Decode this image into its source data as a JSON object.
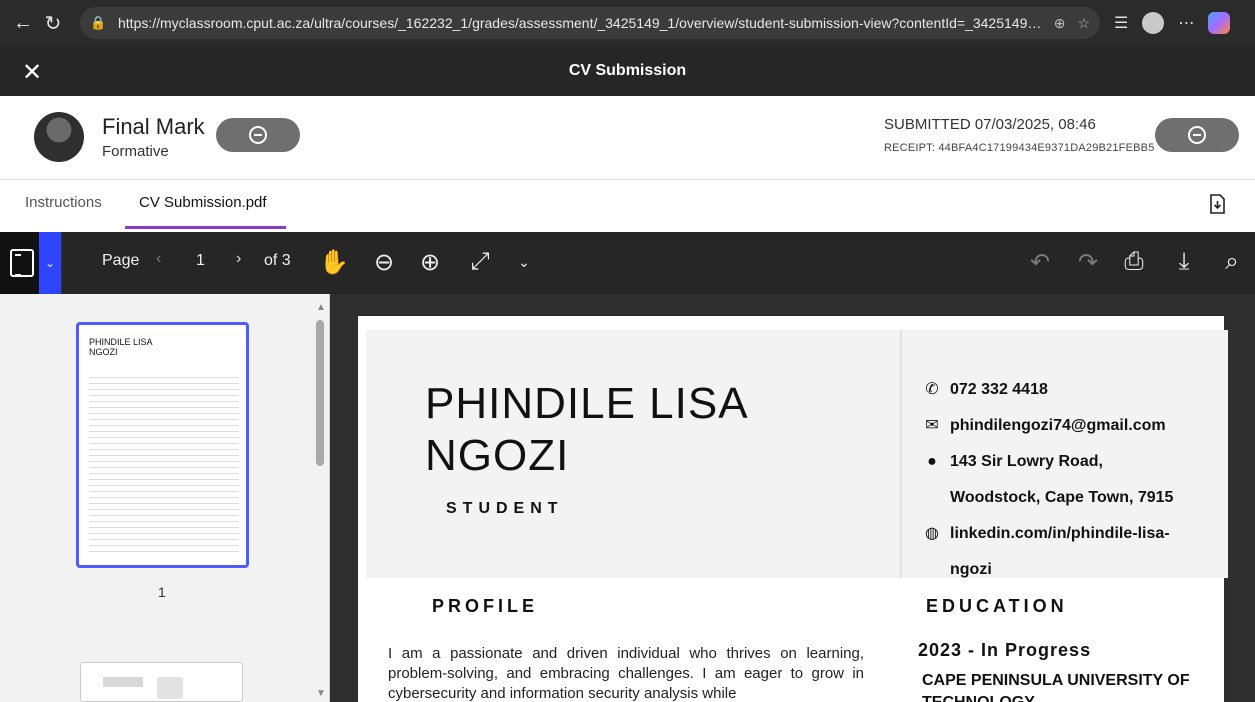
{
  "browser": {
    "url": "https://myclassroom.cput.ac.za/ultra/courses/_162232_1/grades/assessment/_3425149_1/overview/student-submission-view?contentId=_3425149_1&...",
    "back_icon": "back-arrow-icon",
    "refresh_icon": "refresh-icon"
  },
  "app": {
    "title": "CV Submission"
  },
  "marks": {
    "final_mark_label": "Final Mark",
    "final_mark_type": "Formative",
    "submitted": "SUBMITTED 07/03/2025, 08:46",
    "receipt": "RECEIPT: 44BFA4C17199434E9371DA29B21FEBB5"
  },
  "tabs": {
    "instructions": "Instructions",
    "submission": "CV Submission.pdf"
  },
  "toolbar": {
    "page_label": "Page",
    "page_number": "1",
    "of_label": "of 3"
  },
  "thumbnail": {
    "page_number": "1"
  },
  "cv": {
    "name_line1": "PHINDILE LISA",
    "name_line2": "NGOZI",
    "role": "STUDENT",
    "phone": "072 332 4418",
    "email": "phindilengozi74@gmail.com",
    "address_line1": "143 Sir Lowry Road,",
    "address_line2": "Woodstock, Cape Town, 7915",
    "linkedin_line1": "linkedin.com/in/phindile-lisa-",
    "linkedin_line2": "ngozi",
    "profile_heading": "PROFILE",
    "profile_text": "I am a passionate and driven individual who thrives on learning, problem-solving, and embracing challenges. I am eager to grow in cybersecurity and information security analysis while",
    "education_heading": "EDUCATION",
    "education_period": "2023 - In Progress",
    "education_school": "CAPE PENINSULA UNIVERSITY OF TECHNOLOGY"
  },
  "thumb_preview": {
    "name_line1": "PHINDILE LISA",
    "name_line2": "NGOZI"
  }
}
